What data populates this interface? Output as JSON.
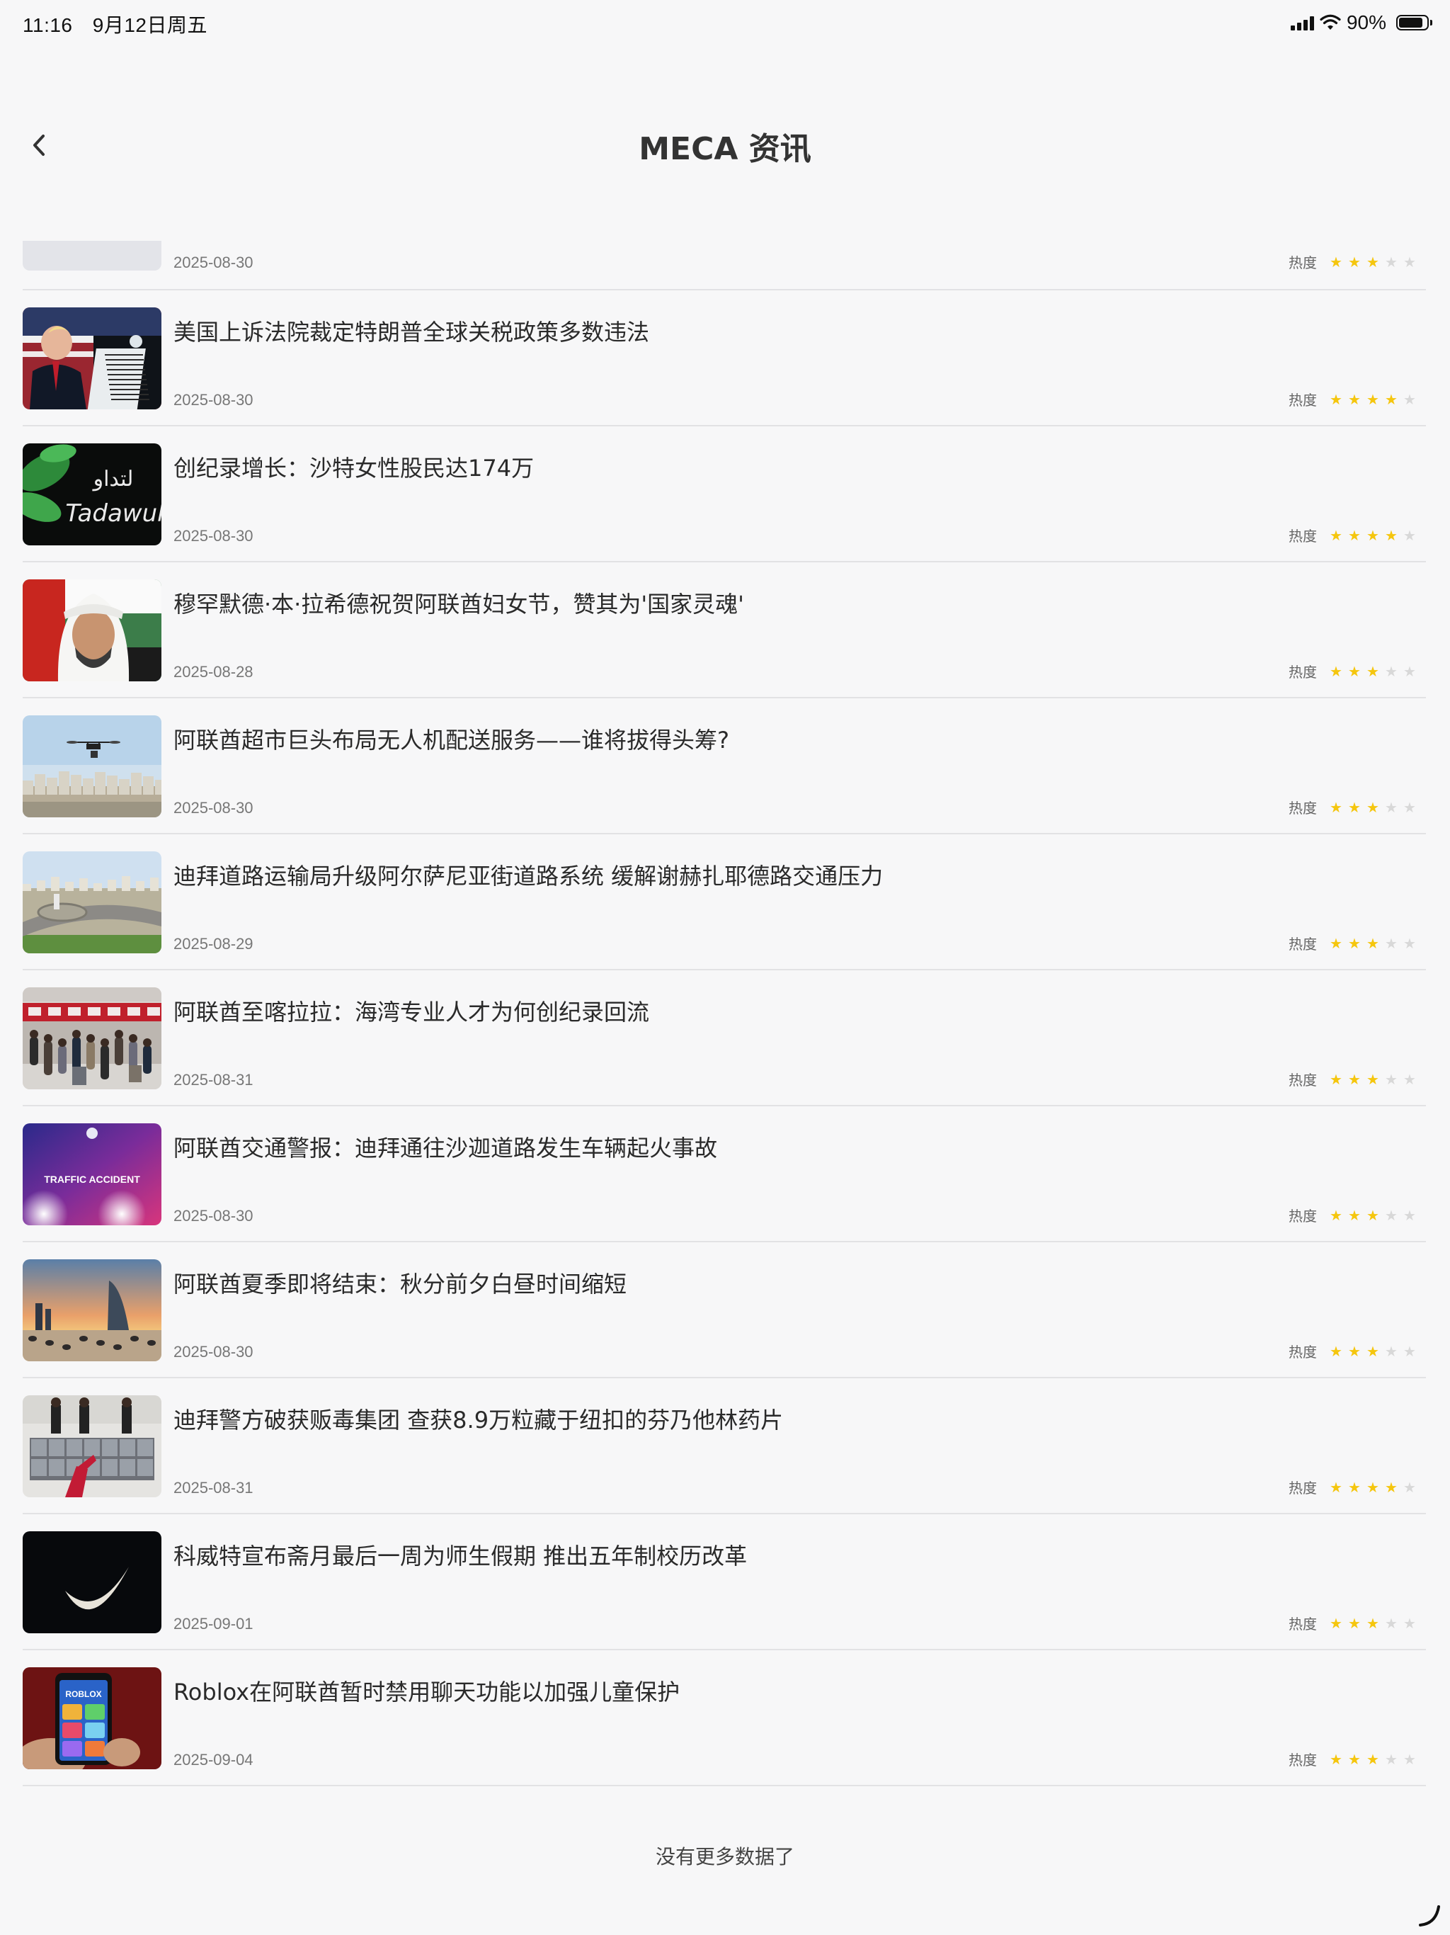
{
  "status_bar": {
    "time": "11:16",
    "date": "9月12日周五",
    "battery_text": "90%",
    "battery_level": 0.9
  },
  "header": {
    "title": "MECA 资讯",
    "back_icon": "chevron-left-icon"
  },
  "heat_label": "热度",
  "news": [
    {
      "title": "",
      "date": "2025-08-30",
      "stars": 3,
      "thumb_icon": "placeholder-image",
      "partial": true
    },
    {
      "title": "美国上诉法院裁定特朗普全球关税政策多数违法",
      "date": "2025-08-30",
      "stars": 4,
      "thumb_icon": "podium-speech-photo"
    },
    {
      "title": "创纪录增长：沙特女性股民达174万",
      "date": "2025-08-30",
      "stars": 4,
      "thumb_icon": "tadawul-logo-photo"
    },
    {
      "title": "穆罕默德·本·拉希德祝贺阿联酋妇女节，赞其为'国家灵魂'",
      "date": "2025-08-28",
      "stars": 3,
      "thumb_icon": "portrait-photo"
    },
    {
      "title": "阿联酋超市巨头布局无人机配送服务——谁将拔得头筹?",
      "date": "2025-08-30",
      "stars": 3,
      "thumb_icon": "drone-city-photo"
    },
    {
      "title": "迪拜道路运输局升级阿尔萨尼亚街道路系统 缓解谢赫扎耶德路交通压力",
      "date": "2025-08-29",
      "stars": 3,
      "thumb_icon": "highway-aerial-photo"
    },
    {
      "title": "阿联酋至喀拉拉：海湾专业人才为何创纪录回流",
      "date": "2025-08-31",
      "stars": 3,
      "thumb_icon": "airport-crowd-photo"
    },
    {
      "title": "阿联酋交通警报：迪拜通往沙迦道路发生车辆起火事故",
      "date": "2025-08-30",
      "stars": 3,
      "thumb_icon": "traffic-accident-graphic",
      "thumb_text": "TRAFFIC ACCIDENT"
    },
    {
      "title": "阿联酋夏季即将结束：秋分前夕白昼时间缩短",
      "date": "2025-08-30",
      "stars": 3,
      "thumb_icon": "beach-sunset-photo"
    },
    {
      "title": "迪拜警方破获贩毒集团 查获8.9万粒藏于纽扣的芬乃他林药片",
      "date": "2025-08-31",
      "stars": 4,
      "thumb_icon": "seized-goods-photo"
    },
    {
      "title": "科威特宣布斋月最后一周为师生假期 推出五年制校历改革",
      "date": "2025-09-01",
      "stars": 3,
      "thumb_icon": "crescent-moon-photo"
    },
    {
      "title": "Roblox在阿联酋暂时禁用聊天功能以加强儿童保护",
      "date": "2025-09-04",
      "stars": 3,
      "thumb_icon": "phone-roblox-photo",
      "thumb_text": "ROBLOX"
    }
  ],
  "footer": {
    "no_more_text": "没有更多数据了"
  }
}
